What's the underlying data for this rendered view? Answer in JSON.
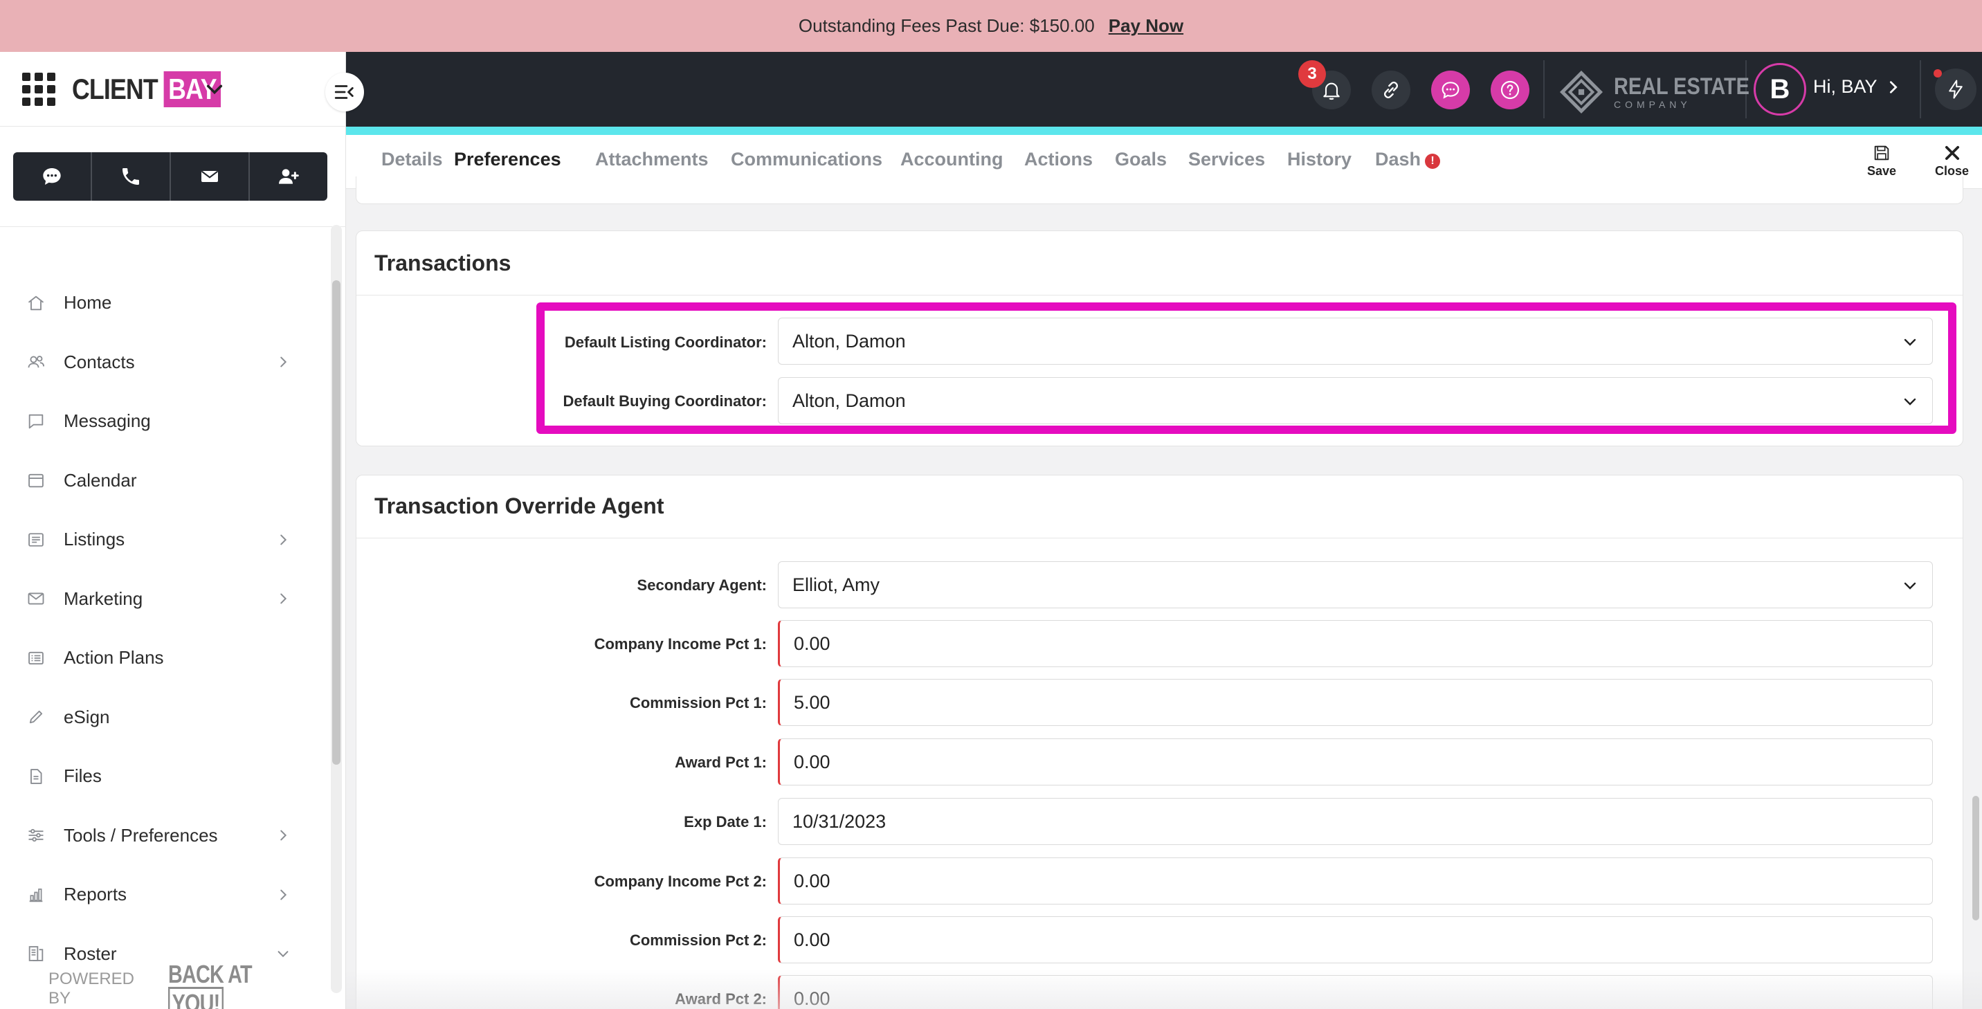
{
  "banner": {
    "text": "Outstanding Fees Past Due: $150.00",
    "link": "Pay Now"
  },
  "brand": {
    "name": "CLIENT",
    "highlight": "BAY"
  },
  "sidebar": {
    "items": [
      {
        "label": "Home",
        "icon": "home-icon",
        "has_chevron": false
      },
      {
        "label": "Contacts",
        "icon": "contacts-icon",
        "has_chevron": true
      },
      {
        "label": "Messaging",
        "icon": "messaging-icon",
        "has_chevron": false
      },
      {
        "label": "Calendar",
        "icon": "calendar-icon",
        "has_chevron": false
      },
      {
        "label": "Listings",
        "icon": "listings-icon",
        "has_chevron": true
      },
      {
        "label": "Marketing",
        "icon": "marketing-icon",
        "has_chevron": true
      },
      {
        "label": "Action Plans",
        "icon": "action-plans-icon",
        "has_chevron": false
      },
      {
        "label": "eSign",
        "icon": "esign-icon",
        "has_chevron": false
      },
      {
        "label": "Files",
        "icon": "files-icon",
        "has_chevron": false
      },
      {
        "label": "Tools / Preferences",
        "icon": "tools-icon",
        "has_chevron": true
      },
      {
        "label": "Reports",
        "icon": "reports-icon",
        "has_chevron": true
      },
      {
        "label": "Roster",
        "icon": "roster-icon",
        "has_chevron": true,
        "expanded": true
      }
    ],
    "powered_by": "POWERED BY",
    "powered_logo_a": "BACK AT",
    "powered_logo_b": "YOU!"
  },
  "header": {
    "notification_count": "3",
    "company_logo_main": "REAL ESTATE",
    "company_logo_sub": "COMPANY",
    "avatar_letter": "B",
    "greeting": "Hi, BAY"
  },
  "tabs": [
    {
      "label": "Details"
    },
    {
      "label": "Preferences",
      "active": true
    },
    {
      "label": "Attachments"
    },
    {
      "label": "Communications"
    },
    {
      "label": "Accounting"
    },
    {
      "label": "Actions"
    },
    {
      "label": "Goals"
    },
    {
      "label": "Services"
    },
    {
      "label": "History"
    },
    {
      "label": "Dash",
      "alert": "!"
    }
  ],
  "toolbar": {
    "save_label": "Save",
    "close_label": "Close"
  },
  "transactions": {
    "title": "Transactions",
    "fields": [
      {
        "label": "Default Listing Coordinator:",
        "value": "Alton, Damon"
      },
      {
        "label": "Default Buying Coordinator:",
        "value": "Alton, Damon"
      }
    ]
  },
  "override": {
    "title": "Transaction Override Agent",
    "fields": [
      {
        "label": "Secondary Agent:",
        "value": "Elliot, Amy",
        "type": "select",
        "required": false
      },
      {
        "label": "Company Income Pct 1:",
        "value": "0.00",
        "type": "text",
        "required": true
      },
      {
        "label": "Commission Pct 1:",
        "value": "5.00",
        "type": "text",
        "required": true
      },
      {
        "label": "Award Pct 1:",
        "value": "0.00",
        "type": "text",
        "required": true
      },
      {
        "label": "Exp Date 1:",
        "value": "10/31/2023",
        "type": "text",
        "required": false
      },
      {
        "label": "Company Income Pct 2:",
        "value": "0.00",
        "type": "text",
        "required": true
      },
      {
        "label": "Commission Pct 2:",
        "value": "0.00",
        "type": "text",
        "required": true
      },
      {
        "label": "Award Pct 2:",
        "value": "0.00",
        "type": "text",
        "required": true
      }
    ]
  },
  "colors": {
    "accent": "#d63ba8",
    "highlight": "#e50cbf",
    "header": "#23272e",
    "cyan": "#5ce6ec",
    "required": "#e03a3e"
  }
}
